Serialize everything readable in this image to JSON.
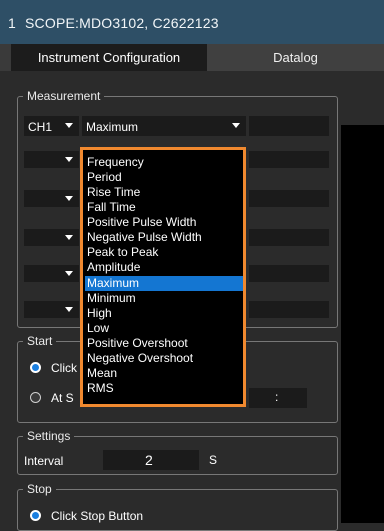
{
  "titlebar": {
    "index": "1",
    "name": "SCOPE:MDO3102, C2622123"
  },
  "tabs": [
    {
      "label": "Instrument Configuration",
      "active": true
    },
    {
      "label": "Datalog",
      "active": false
    }
  ],
  "measurement": {
    "label": "Measurement",
    "channel": "CH1",
    "selected": "Maximum"
  },
  "dropdown": {
    "options": [
      "Frequency",
      "Period",
      "Rise Time",
      "Fall Time",
      "Positive Pulse Width",
      "Negative Pulse Width",
      "Peak to Peak",
      "Amplitude",
      "Maximum",
      "Minimum",
      "High",
      "Low",
      "Positive Overshoot",
      "Negative Overshoot",
      "Mean",
      "RMS"
    ],
    "highlighted": "Maximum",
    "border_color": "#f0892f",
    "highlight_color": "#1476d2"
  },
  "start": {
    "label": "Start",
    "option1": "Click",
    "option2": "At S",
    "time_sep": ":"
  },
  "settings": {
    "label": "Settings",
    "interval_label": "Interval",
    "interval_value": "2",
    "unit": "S"
  },
  "stop": {
    "label": "Stop",
    "option1": "Click Stop Button"
  },
  "colors": {
    "titlebar": "#2e4f66",
    "radio_on": "#1a7fe0"
  }
}
